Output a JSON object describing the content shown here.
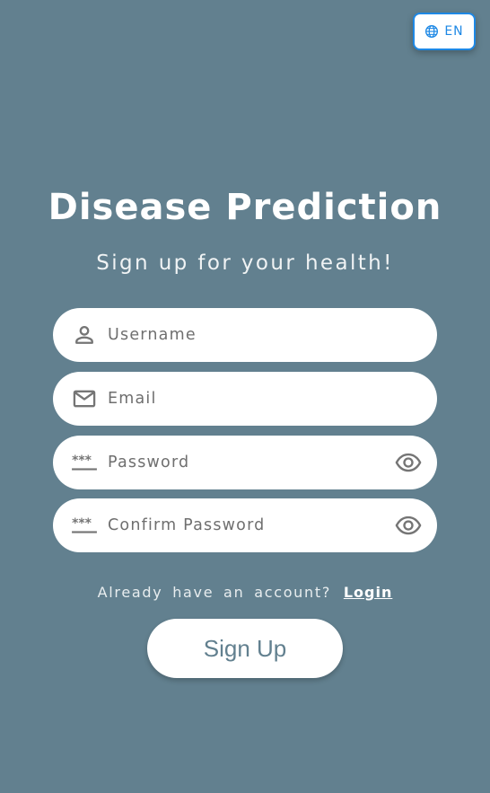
{
  "theme": {
    "background": "#62808f",
    "accent": "#1e88e5",
    "field_background": "#ffffff",
    "icon_color": "#757575"
  },
  "language_toggle": {
    "icon": "globe-icon",
    "label": "EN"
  },
  "header": {
    "title": "Disease Prediction",
    "subtitle": "Sign up for your health!"
  },
  "form": {
    "username": {
      "icon": "person-icon",
      "placeholder": "Username",
      "value": ""
    },
    "email": {
      "icon": "mail-icon",
      "placeholder": "Email",
      "value": ""
    },
    "password": {
      "icon": "password-icon",
      "placeholder": "Password",
      "value": "",
      "toggle_icon": "eye-icon"
    },
    "confirm_password": {
      "icon": "password-icon",
      "placeholder": "Confirm Password",
      "value": "",
      "toggle_icon": "eye-icon"
    }
  },
  "login_prompt": {
    "text": "Already have an account?",
    "link_label": "Login"
  },
  "signup_button": {
    "label": "Sign Up"
  }
}
